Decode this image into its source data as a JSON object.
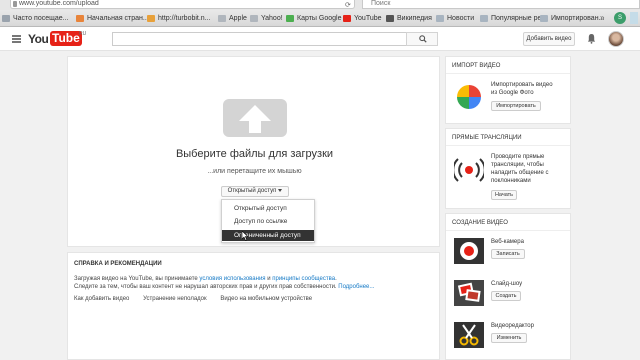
{
  "browser": {
    "url": "www.youtube.com/upload",
    "search_placeholder": "Поиск",
    "bookmarks": [
      {
        "label": "Часто посещае...",
        "color": "#9aa3ad"
      },
      {
        "label": "Начальная стран...",
        "color": "#e8843a"
      },
      {
        "label": "http://turbobit.n...",
        "color": "#e8a13a"
      },
      {
        "label": "Apple",
        "color": "#b0b6bd"
      },
      {
        "label": "Yahoo!",
        "color": "#b0b6bd"
      },
      {
        "label": "Карты Google",
        "color": "#4caf50"
      },
      {
        "label": "YouTube",
        "color": "#e62117"
      },
      {
        "label": "Википедия",
        "color": "#555555"
      },
      {
        "label": "Новости",
        "color": "#a8b4c0"
      },
      {
        "label": "Популярные ре...",
        "color": "#a8b4c0"
      },
      {
        "label": "Импортирован...",
        "color": "#a8b4c0"
      }
    ]
  },
  "header": {
    "logo_you": "You",
    "logo_tube": "Tube",
    "logo_region": "RU",
    "upload_label": "Добавить видео"
  },
  "upload": {
    "title": "Выберите файлы для загрузки",
    "subtitle": "...или перетащите их мышью",
    "privacy_label": "Открытый доступ",
    "options": [
      "Открытый доступ",
      "Доступ по ссылке",
      "Ограниченный доступ"
    ],
    "selected_index": 2
  },
  "help": {
    "title": "СПРАВКА И РЕКОМЕНДАЦИИ",
    "line1_pre": "Загружая видео на YouTube, вы принимаете ",
    "line1_link1": "условия использования",
    "line1_mid": " и ",
    "line1_link2": "принципы сообщества",
    "line1_post": ".",
    "line2_pre": "Следите за тем, чтобы ваш контент не нарушал авторских прав и других прав собственности. ",
    "line2_link": "Подробнее...",
    "links": [
      "Как добавить видео",
      "Устранение неполадок",
      "Видео на мобильном устройстве"
    ]
  },
  "sidebar": {
    "import": {
      "title": "ИМПОРТ ВИДЕО",
      "text1": "Импортировать видео",
      "text2": "из Google Фото",
      "button": "Импортировать"
    },
    "live": {
      "title": "ПРЯМЫЕ ТРАНСЛЯЦИИ",
      "text1": "Проводите прямые",
      "text2": "трансляции, чтобы",
      "text3": "наладить общение с",
      "text4": "поклонниками",
      "button": "Начать"
    },
    "create": {
      "title": "СОЗДАНИЕ ВИДЕО",
      "items": [
        {
          "label": "Веб-камера",
          "button": "Записать"
        },
        {
          "label": "Слайд-шоу",
          "button": "Создать"
        },
        {
          "label": "Видеоредактор",
          "button": "Изменить"
        }
      ]
    }
  },
  "colors": {
    "brand_red": "#e62117",
    "link_blue": "#167ac6",
    "dark_selected": "#333333"
  }
}
